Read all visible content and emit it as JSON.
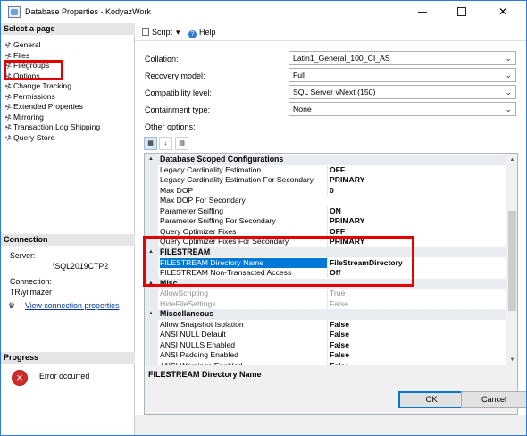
{
  "window": {
    "title": "Database Properties - KodyazWork",
    "minimize_label": "—",
    "maximize_label": "☐",
    "close_label": "✕"
  },
  "left_pane": {
    "select_page_title": "Select a page",
    "pages": [
      "General",
      "Files",
      "Filegroups",
      "Options",
      "Change Tracking",
      "Permissions",
      "Extended Properties",
      "Mirroring",
      "Transaction Log Shipping",
      "Query Store"
    ],
    "selected_page_index": 3,
    "connection_title": "Connection",
    "server_label": "Server:",
    "server_value": "\\SQL2019CTP2",
    "connection_label": "Connection:",
    "connection_value": "TR\\yilmazer",
    "view_connection_link": "View connection properties",
    "progress_title": "Progress",
    "progress_status": "Error occurred"
  },
  "toolbar": {
    "script_label": "Script",
    "script_dropdown_icon": "caret-down",
    "help_label": "Help"
  },
  "settings": {
    "collation_label": "Collation:",
    "collation_value": "Latin1_General_100_CI_AS",
    "recovery_model_label": "Recovery model:",
    "recovery_model_value": "Full",
    "compatibility_level_label": "Compatibility level:",
    "compatibility_level_value": "SQL Server vNext (150)",
    "containment_type_label": "Containment type:",
    "containment_type_value": "None",
    "other_options_label": "Other options:"
  },
  "property_grid": {
    "categories": [
      {
        "name": "Database Scoped Configurations",
        "rows": [
          {
            "name": "Legacy Cardinality Estimation",
            "value": "OFF"
          },
          {
            "name": "Legacy Cardinality Estimation For Secondary",
            "value": "PRIMARY"
          },
          {
            "name": "Max DOP",
            "value": "0"
          },
          {
            "name": "Max DOP For Secondary",
            "value": ""
          },
          {
            "name": "Parameter Sniffing",
            "value": "ON"
          },
          {
            "name": "Parameter Sniffing For Secondary",
            "value": "PRIMARY"
          },
          {
            "name": "Query Optimizer Fixes",
            "value": "OFF"
          },
          {
            "name": "Query Optimizer Fixes For Secondary",
            "value": "PRIMARY"
          }
        ]
      },
      {
        "name": "FILESTREAM",
        "rows": [
          {
            "name": "FILESTREAM Directory Name",
            "value": "FileStreamDirectory",
            "selected": true
          },
          {
            "name": "FILESTREAM Non-Transacted Access",
            "value": "Off"
          }
        ]
      },
      {
        "name": "Misc",
        "rows": [
          {
            "name": "AllowScripting",
            "value": "True",
            "disabled": true
          },
          {
            "name": "HideFileSettings",
            "value": "False",
            "disabled": true
          }
        ]
      },
      {
        "name": "Miscellaneous",
        "rows": [
          {
            "name": "Allow Snapshot Isolation",
            "value": "False"
          },
          {
            "name": "ANSI NULL Default",
            "value": "False"
          },
          {
            "name": "ANSI NULLS Enabled",
            "value": "False"
          },
          {
            "name": "ANSI Padding Enabled",
            "value": "False"
          },
          {
            "name": "ANSI Warnings Enabled",
            "value": "False"
          }
        ]
      }
    ],
    "description_title": "FILESTREAM Directory Name"
  },
  "buttons": {
    "ok_label": "OK",
    "cancel_label": "Cancel"
  },
  "colors": {
    "highlight": "#e60000",
    "selection": "#0078d7",
    "link": "#003399"
  }
}
